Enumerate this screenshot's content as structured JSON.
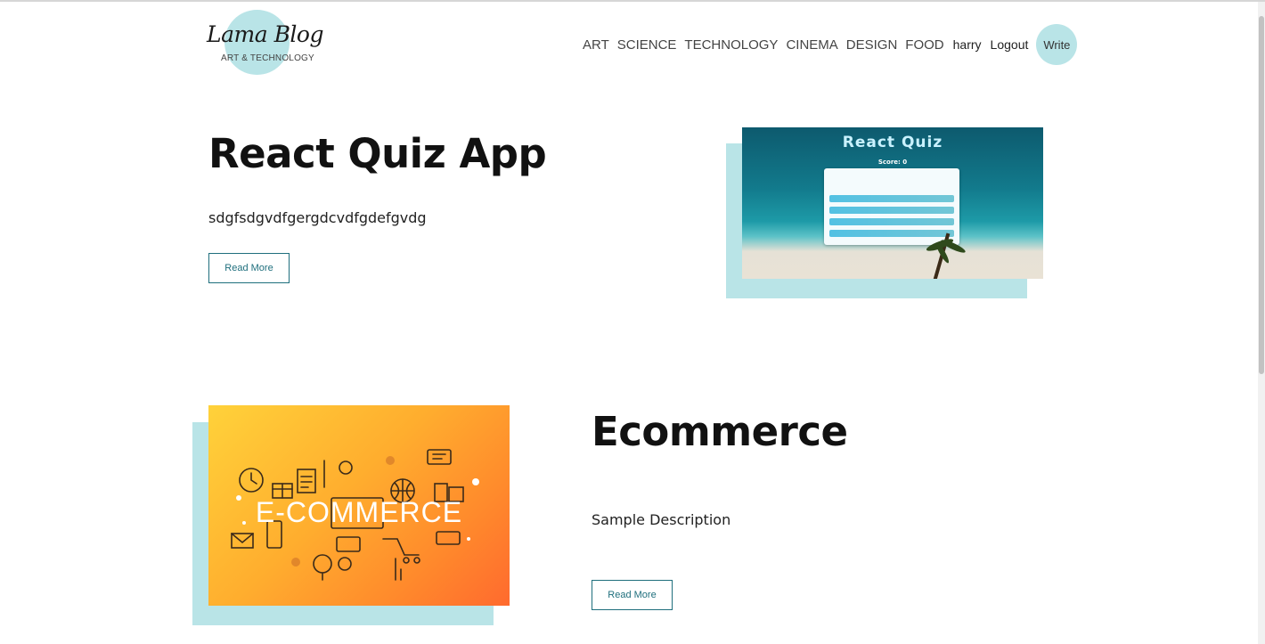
{
  "logo": {
    "title": "Lama Blog",
    "subtitle": "ART & TECHNOLOGY"
  },
  "nav": {
    "links": [
      "ART",
      "SCIENCE",
      "TECHNOLOGY",
      "CINEMA",
      "DESIGN",
      "FOOD"
    ],
    "username": "harry",
    "logout_label": "Logout",
    "write_label": "Write"
  },
  "posts": [
    {
      "title": "React Quiz App",
      "description": "sdgfsdgvdfgergdcvdfgdefgvdg",
      "read_more_label": "Read More",
      "image": {
        "title": "React Quiz",
        "score": "Score: 0"
      }
    },
    {
      "title": "Ecommerce",
      "description": "Sample Description",
      "read_more_label": "Read More",
      "image": {
        "text": "E-COMMERCE"
      }
    }
  ],
  "colors": {
    "accent": "#b9e4e7",
    "button_border": "#1f6f7d"
  }
}
